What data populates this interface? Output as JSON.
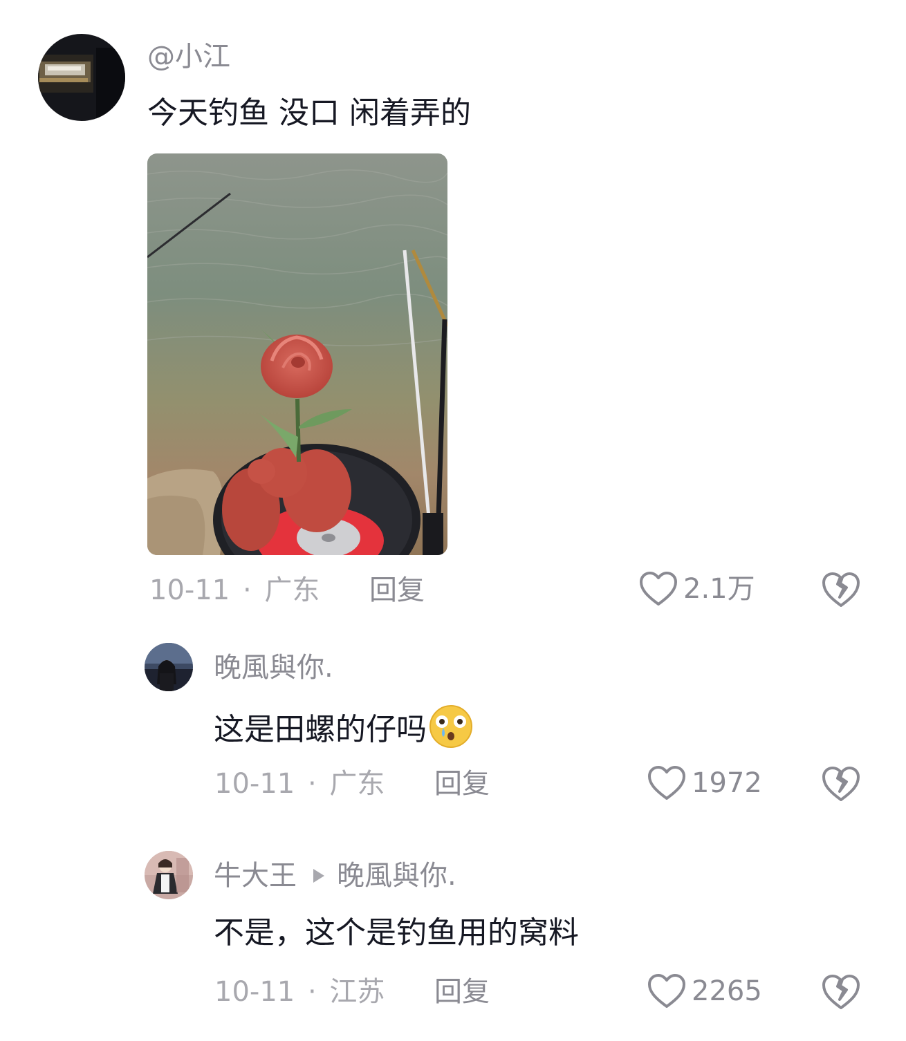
{
  "comments": [
    {
      "username": "@小江",
      "text": "今天钓鱼 没口 闲着弄的",
      "date": "10-11",
      "sep": "·",
      "location": "广东",
      "reply_label": "回复",
      "likes": "2.1万",
      "has_image": true
    },
    {
      "username": "晚風與你.",
      "text": "这是田螺的仔吗",
      "emoji": "astonished-tear-emoji",
      "date": "10-11",
      "sep": "·",
      "location": "广东",
      "reply_label": "回复",
      "likes": "1972"
    },
    {
      "username": "牛大王",
      "reply_to": "晚風與你.",
      "text": "不是，这个是钓鱼用的窝料",
      "date": "10-11",
      "sep": "·",
      "location": "江苏",
      "reply_label": "回复",
      "likes": "2265"
    }
  ],
  "icons": {
    "like": "heart-outline-icon",
    "dislike": "broken-heart-icon",
    "reply_arrow": "triangle-right-icon"
  },
  "colors": {
    "text_primary": "#161823",
    "text_secondary": "#8a8a92",
    "text_meta": "#a8a8ae"
  }
}
